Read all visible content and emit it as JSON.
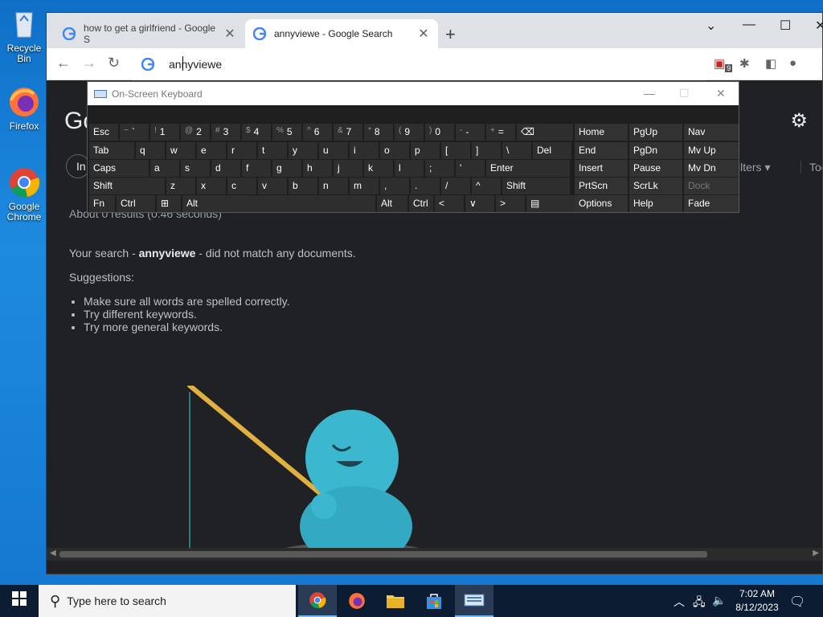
{
  "desktop": {
    "icons": [
      {
        "label": "Recycle Bin",
        "icon": "recycle-bin-icon"
      },
      {
        "label": "Firefox",
        "icon": "firefox-icon"
      },
      {
        "label": "Google Chrome",
        "icon": "chrome-icon"
      }
    ]
  },
  "browser": {
    "tabs": [
      {
        "title": "how to get a girlfriend - Google S",
        "active": false
      },
      {
        "title": "annyviewe - Google Search",
        "active": true
      }
    ],
    "address": "annyviewe",
    "extension_badge": "9"
  },
  "page": {
    "logo": "Go",
    "chip_partial": "In",
    "filters_label": "ilters",
    "tools_label": "Tool",
    "stats": "About 0 results (0.46 seconds)",
    "no_results_prefix": "Your search - ",
    "query": "annyviewe",
    "no_results_suffix": " - did not match any documents.",
    "suggestions_label": "Suggestions:",
    "suggestions": [
      "Make sure all words are spelled correctly.",
      "Try different keywords.",
      "Try more general keywords."
    ]
  },
  "osk": {
    "title": "On-Screen Keyboard",
    "row1": [
      {
        "main": "Esc"
      },
      {
        "shift": "~",
        "main": "`"
      },
      {
        "shift": "!",
        "main": "1"
      },
      {
        "shift": "@",
        "main": "2"
      },
      {
        "shift": "#",
        "main": "3"
      },
      {
        "shift": "$",
        "main": "4"
      },
      {
        "shift": "%",
        "main": "5"
      },
      {
        "shift": "^",
        "main": "6"
      },
      {
        "shift": "&",
        "main": "7"
      },
      {
        "shift": "*",
        "main": "8"
      },
      {
        "shift": "(",
        "main": "9"
      },
      {
        "shift": ")",
        "main": "0"
      },
      {
        "shift": "-",
        "main": "-"
      },
      {
        "shift": "+",
        "main": "="
      },
      {
        "main": "⌫"
      }
    ],
    "row2": [
      "Tab",
      "q",
      "w",
      "e",
      "r",
      "t",
      "y",
      "u",
      "i",
      "o",
      "p",
      "[",
      "]",
      "\\",
      "Del"
    ],
    "row3": [
      "Caps",
      "a",
      "s",
      "d",
      "f",
      "g",
      "h",
      "j",
      "k",
      "l",
      ";",
      "'",
      "Enter"
    ],
    "row4": [
      "Shift",
      "z",
      "x",
      "c",
      "v",
      "b",
      "n",
      "m",
      ",",
      ".",
      "/",
      "^",
      "Shift"
    ],
    "row5": [
      "Fn",
      "Ctrl",
      "⊞",
      "Alt",
      "Alt",
      "Ctrl",
      "<",
      "∨",
      ">",
      "▤"
    ],
    "nav_keys": [
      [
        "Home",
        "PgUp",
        "Nav"
      ],
      [
        "End",
        "PgDn",
        "Mv Up"
      ],
      [
        "Insert",
        "Pause",
        "Mv Dn"
      ],
      [
        "PrtScn",
        "ScrLk",
        "Dock"
      ],
      [
        "Options",
        "Help",
        "Fade"
      ]
    ]
  },
  "taskbar": {
    "search_placeholder": "Type here to search",
    "time": "7:02 AM",
    "date": "8/12/2023"
  }
}
